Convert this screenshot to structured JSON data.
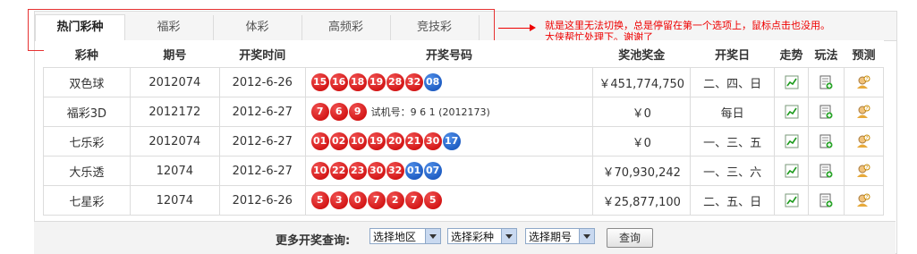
{
  "tabs": [
    "热门彩种",
    "福彩",
    "体彩",
    "高频彩",
    "竞技彩"
  ],
  "note": {
    "line1": "就是这里无法切换，总是停留在第一个选项上，鼠标点击也没用。",
    "line2": "大侠帮忙处理下。谢谢了"
  },
  "table": {
    "headers": [
      "彩种",
      "期号",
      "开奖时间",
      "开奖号码",
      "奖池奖金",
      "开奖日",
      "走势",
      "玩法",
      "预测"
    ],
    "rows": [
      {
        "name": "双色球",
        "issue": "2012074",
        "date": "2012-6-26",
        "red": [
          "15",
          "16",
          "18",
          "19",
          "28",
          "32"
        ],
        "blue": [
          "08"
        ],
        "trial": "",
        "prize": "￥451,774,750",
        "days": "二、四、日"
      },
      {
        "name": "福彩3D",
        "issue": "2012172",
        "date": "2012-6-27",
        "red": [
          "7",
          "6",
          "9"
        ],
        "blue": [],
        "trial": "试机号：9 6 1  (2012173)",
        "prize": "￥0",
        "days": "每日"
      },
      {
        "name": "七乐彩",
        "issue": "2012074",
        "date": "2012-6-27",
        "red": [
          "01",
          "02",
          "10",
          "19",
          "20",
          "21",
          "30"
        ],
        "blue": [
          "17"
        ],
        "trial": "",
        "prize": "￥0",
        "days": "一、三、五"
      },
      {
        "name": "大乐透",
        "issue": "12074",
        "date": "2012-6-27",
        "red": [
          "10",
          "22",
          "23",
          "30",
          "32"
        ],
        "blue": [
          "01",
          "07"
        ],
        "trial": "",
        "prize": "￥70,930,242",
        "days": "一、三、六"
      },
      {
        "name": "七星彩",
        "issue": "12074",
        "date": "2012-6-26",
        "red": [
          "5",
          "3",
          "0",
          "7",
          "2",
          "7",
          "5"
        ],
        "blue": [],
        "trial": "",
        "prize": "￥25,877,100",
        "days": "二、五、日"
      }
    ]
  },
  "footer": {
    "label": "更多开奖查询:",
    "select_area": "选择地区",
    "select_type": "选择彩种",
    "select_issue": "选择期号",
    "query": "查询"
  },
  "colors": {
    "red_ball": "#d00000",
    "blue_ball": "#1555c5",
    "prize": "#e0301e",
    "annotation": "#e00000"
  }
}
